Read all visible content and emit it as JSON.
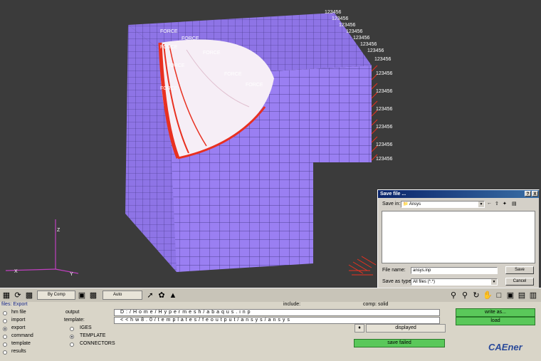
{
  "viewport": {
    "force_label": "FORCE",
    "dof_label": "123456",
    "axes": {
      "x": "X",
      "y": "Y",
      "z": "Z"
    }
  },
  "save_dialog": {
    "title": "Save file ...",
    "help_btn": "?",
    "close_btn": "X",
    "save_in_label": "Save in:",
    "save_in_value": "Ansys",
    "file_name_label": "File name:",
    "file_name_value": "ansys.inp",
    "save_as_type_label": "Save as type:",
    "save_as_type_value": "All files (*.*)",
    "save_button": "Save",
    "cancel_button": "Cancel"
  },
  "toolbar": {
    "display_mode": "By Comp",
    "auto_mode": "Auto"
  },
  "panel": {
    "title": "files: Export",
    "menu": [
      {
        "label": "hm file",
        "selected": false
      },
      {
        "label": "import",
        "selected": false
      },
      {
        "label": "export",
        "selected": true
      },
      {
        "label": "command",
        "selected": false
      },
      {
        "label": "template",
        "selected": false
      },
      {
        "label": "results",
        "selected": false
      }
    ],
    "output_label": "output",
    "output_value": "D:/Home/Hypermesh/abaqus.inp",
    "template_label": "template:",
    "template_value": "<<hw8.0/templates/feoutput/ansys/ansys",
    "include_label": "include:",
    "comp_label": "comp: solid",
    "format_options": [
      {
        "label": "IGES",
        "selected": false
      },
      {
        "label": "TEMPLATE",
        "selected": true
      },
      {
        "label": "CONNECTORS",
        "selected": false
      }
    ],
    "displayed_button": "displayed",
    "save_status": "save failed",
    "write_as_button": "write as...",
    "load_button": "load",
    "watermark": "CAEner"
  },
  "colors": {
    "mesh": "#9a7ff2",
    "force": "#e83020",
    "viewport_bg": "#3b3b3b",
    "status_green": "#5ac85a"
  }
}
